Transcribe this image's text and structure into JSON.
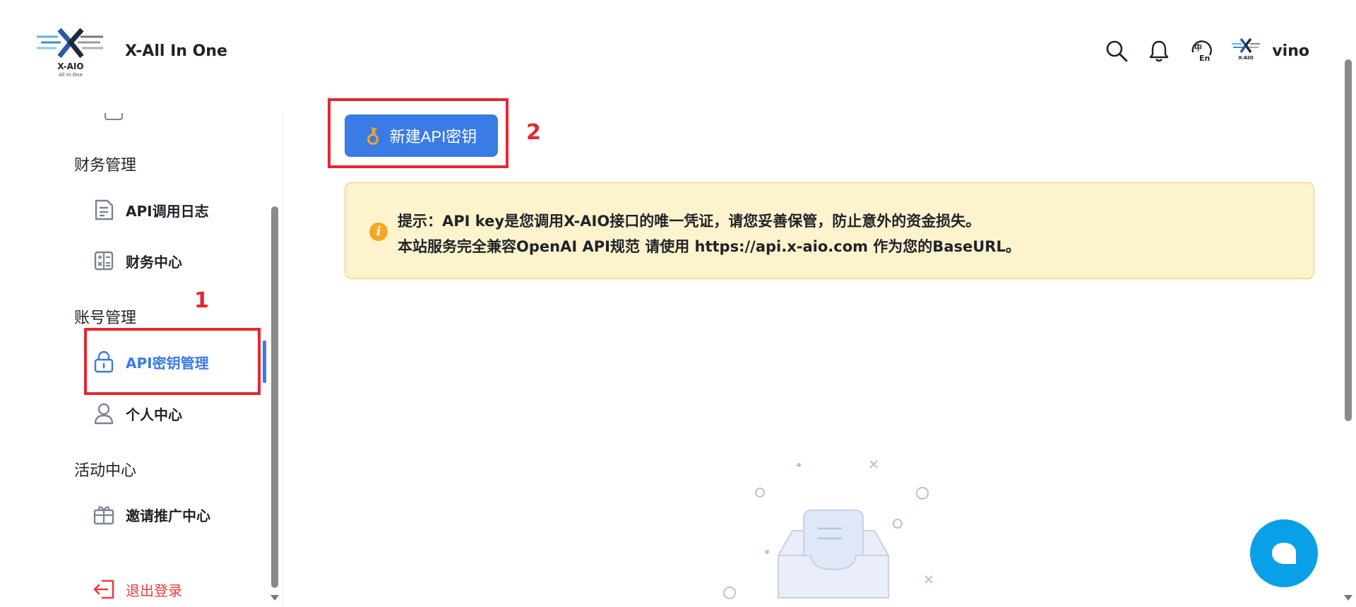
{
  "header": {
    "logo_text": "X-AIO",
    "logo_sub": "All In One",
    "app_title": "X-All In One",
    "username": "vino",
    "icons": [
      "search-icon",
      "bell-icon",
      "language-icon",
      "avatar"
    ]
  },
  "sidebar": {
    "groups": [
      {
        "title": "财务管理",
        "items": [
          {
            "label": "API调用日志",
            "icon": "document-icon"
          },
          {
            "label": "财务中心",
            "icon": "calculator-icon"
          }
        ]
      },
      {
        "title": "账号管理",
        "items": [
          {
            "label": "API密钥管理",
            "icon": "lock-icon",
            "active": true
          },
          {
            "label": "个人中心",
            "icon": "user-icon"
          }
        ]
      },
      {
        "title": "活动中心",
        "items": [
          {
            "label": "邀请推广中心",
            "icon": "gift-icon"
          }
        ]
      }
    ],
    "logout_label": "退出登录"
  },
  "annotations": {
    "marker_1": "1",
    "marker_2": "2"
  },
  "main": {
    "new_key_button": "新建API密钥",
    "notice_line1": "提示：API key是您调用X-AIO接口的唯一凭证，请您妥善保管，防止意外的资金损失。",
    "notice_line2": "本站服务完全兼容OpenAI API规范 请使用 https://api.x-aio.com 作为您的BaseURL。"
  },
  "colors": {
    "accent": "#3a7be5",
    "notice_bg": "#fdf3cc",
    "annotation_red": "#e8262f",
    "chat_fab": "#0aa0e8",
    "logout_red": "#ee3b3b"
  }
}
